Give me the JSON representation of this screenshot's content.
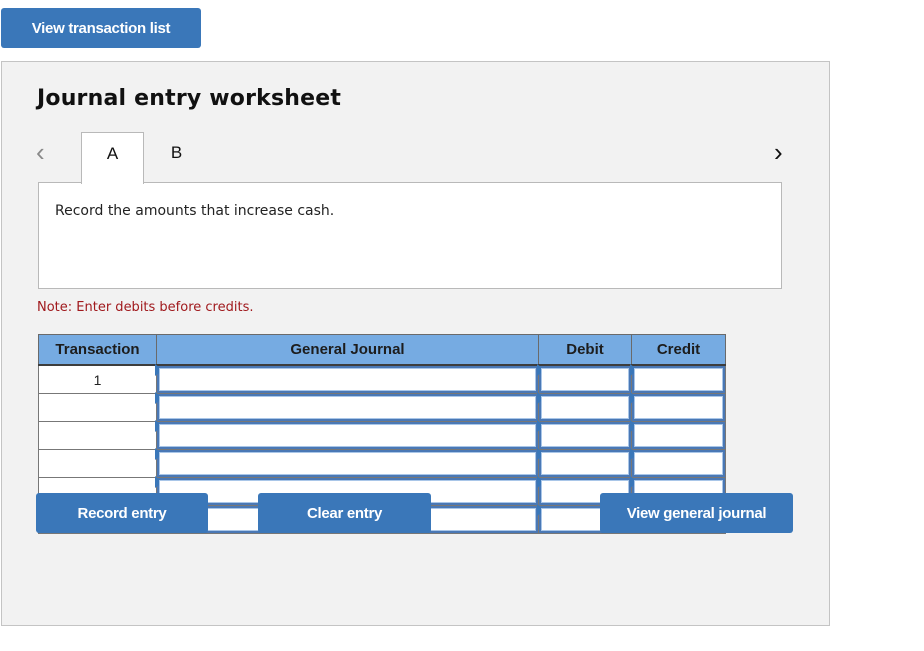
{
  "header": {
    "view_transaction_list_label": "View transaction list"
  },
  "worksheet": {
    "title": "Journal entry worksheet",
    "nav_prev_icon": "chevron-left-icon",
    "nav_next_icon": "chevron-right-icon",
    "tabs": [
      {
        "label": "A",
        "active": true
      },
      {
        "label": "B",
        "active": false
      }
    ],
    "prompt": "Record the amounts that increase cash.",
    "note": "Note: Enter debits before credits.",
    "accent_color": "#3a77b9",
    "header_color": "#76abe2",
    "note_color": "#a0191d"
  },
  "table": {
    "columns": [
      "Transaction",
      "General Journal",
      "Debit",
      "Credit"
    ],
    "rows": [
      {
        "transaction": "1",
        "account": "",
        "debit": "",
        "credit": ""
      },
      {
        "transaction": "",
        "account": "",
        "debit": "",
        "credit": ""
      },
      {
        "transaction": "",
        "account": "",
        "debit": "",
        "credit": ""
      },
      {
        "transaction": "",
        "account": "",
        "debit": "",
        "credit": ""
      },
      {
        "transaction": "",
        "account": "",
        "debit": "",
        "credit": ""
      },
      {
        "transaction": "",
        "account": "",
        "debit": "",
        "credit": ""
      }
    ]
  },
  "actions": {
    "record_entry_label": "Record entry",
    "clear_entry_label": "Clear entry",
    "view_general_journal_label": "View general journal"
  }
}
